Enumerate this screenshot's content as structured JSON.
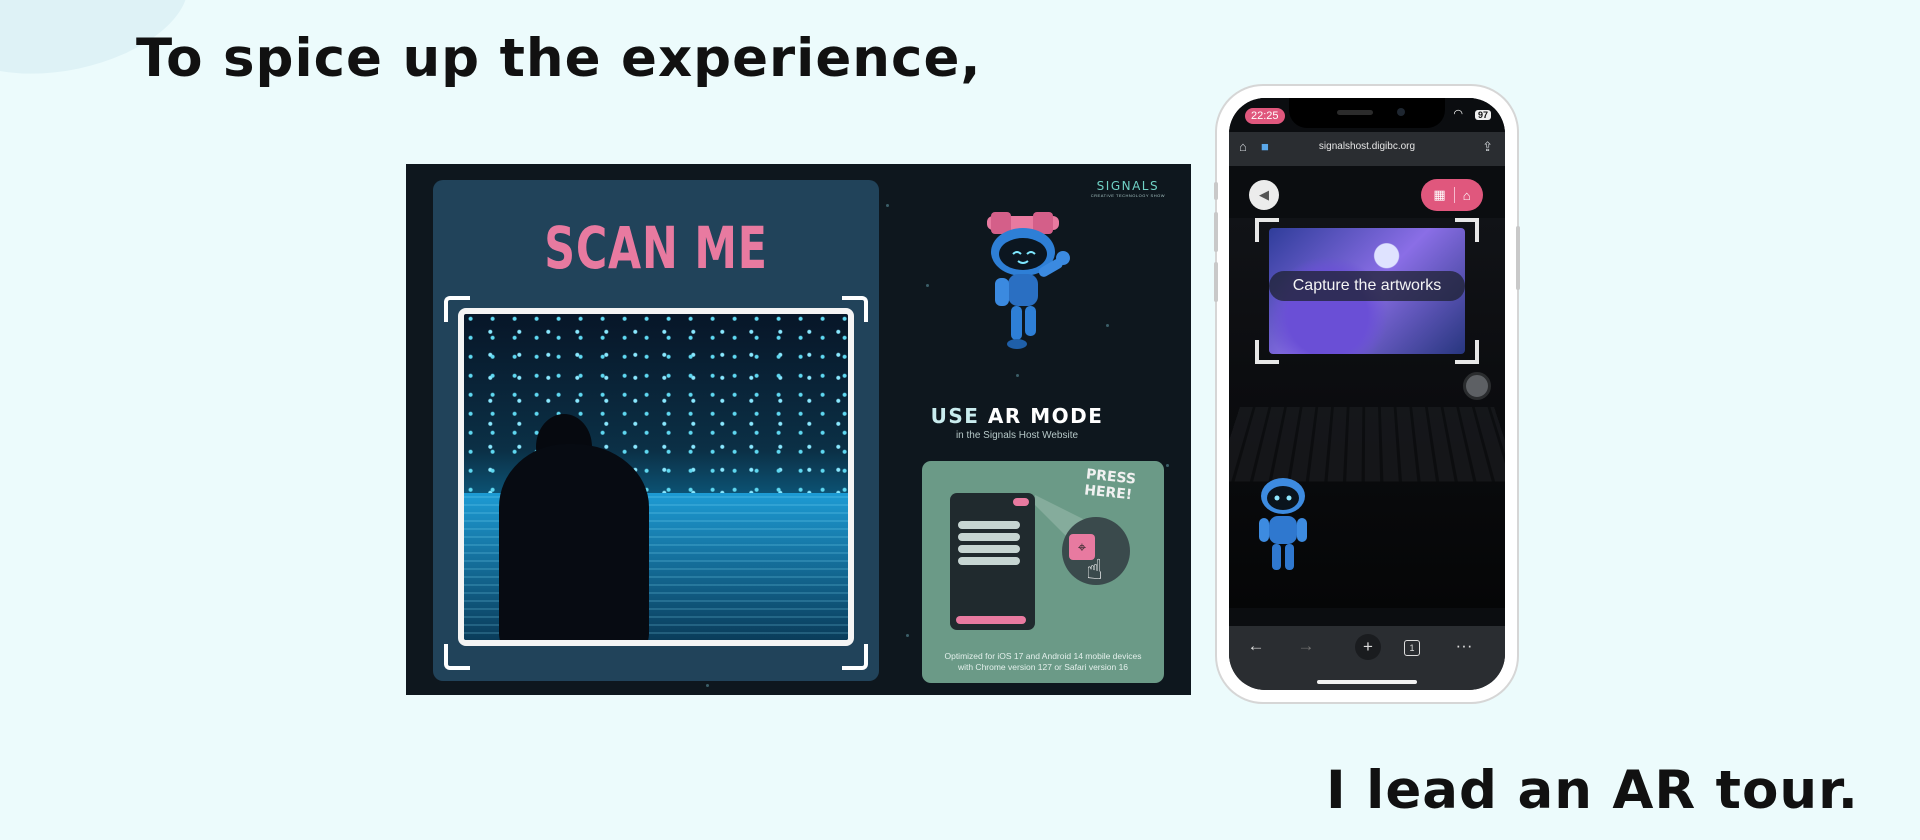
{
  "headline_top": "To spice up the experience,",
  "headline_bottom": "I lead an AR tour.",
  "poster": {
    "scan_title": "SCAN ME",
    "logo_text": "SIGNALS",
    "logo_subtitle": "CREATIVE TECHNOLOGY SHOW",
    "ar_title_plain": "USE ",
    "ar_title_bold": "AR MODE",
    "ar_subtitle": "in the Signals Host Website",
    "press_text_line1": "PRESS",
    "press_text_line2": "HERE!",
    "optimized_line1": "Optimized for iOS 17 and Android 14 mobile devices",
    "optimized_line2": "with Chrome version 127 or Safari version 16",
    "accent_color": "#e87aa0"
  },
  "phone": {
    "time": "22:25",
    "battery": "97",
    "url": "signalshost.digibc.org",
    "capture_label": "Capture the artworks",
    "tab_count": "1",
    "accent_color": "#e0577d"
  },
  "icons": {
    "wifi": "wifi-icon",
    "home": "home-icon",
    "camera": "video-camera-icon",
    "share": "share-icon",
    "sound": "speaker-icon",
    "map": "map-icon",
    "back": "arrow-left-icon",
    "forward": "arrow-right-icon",
    "new_tab": "plus-icon",
    "tabs": "tab-count-icon",
    "more": "more-icon"
  }
}
